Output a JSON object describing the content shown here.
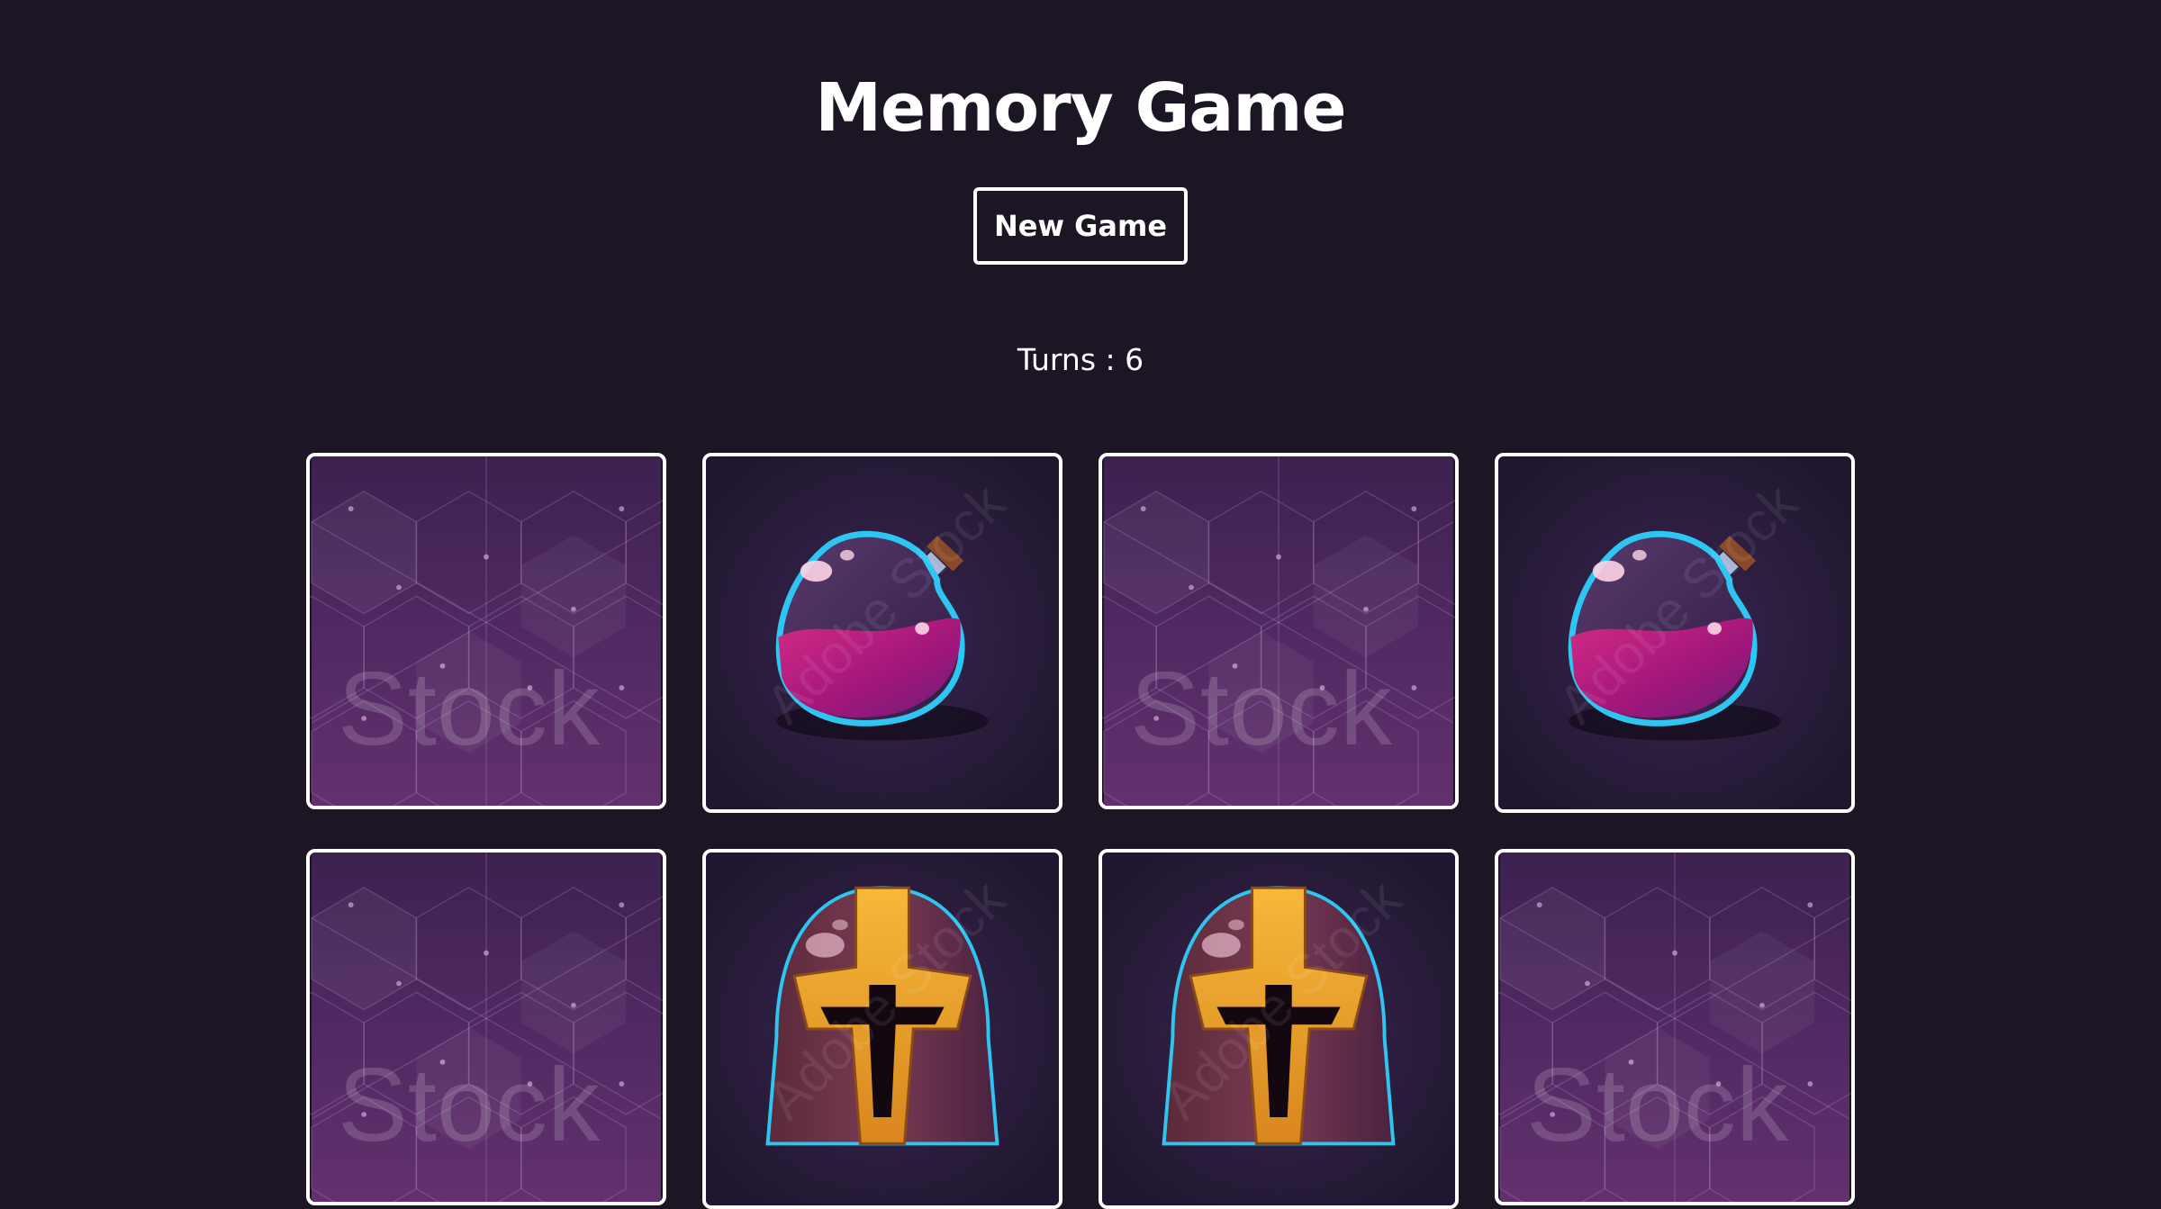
{
  "header": {
    "title": "Memory Game"
  },
  "controls": {
    "new_game_label": "New Game"
  },
  "status": {
    "turns_text": "Turns : 6"
  },
  "colors": {
    "background": "#1c1624",
    "card_border": "#ffffff",
    "card_back": "#4a2658",
    "card_front": "#251a33"
  },
  "cards": [
    {
      "state": "face-down",
      "image": "hexagon-pattern-card-back",
      "watermark": "Stock"
    },
    {
      "state": "face-up",
      "image": "potion-flask-icon",
      "watermark": "Adobe Stock"
    },
    {
      "state": "face-down",
      "image": "hexagon-pattern-card-back",
      "watermark": "Stock"
    },
    {
      "state": "face-up",
      "image": "potion-flask-icon",
      "watermark": "Adobe Stock"
    },
    {
      "state": "face-down",
      "image": "hexagon-pattern-card-back",
      "watermark": "Stock"
    },
    {
      "state": "face-up",
      "image": "knight-helmet-icon",
      "watermark": "Adobe Stock"
    },
    {
      "state": "face-up",
      "image": "knight-helmet-icon",
      "watermark": "Adobe Stock"
    },
    {
      "state": "face-down",
      "image": "hexagon-pattern-card-back",
      "watermark": "Stock"
    }
  ]
}
